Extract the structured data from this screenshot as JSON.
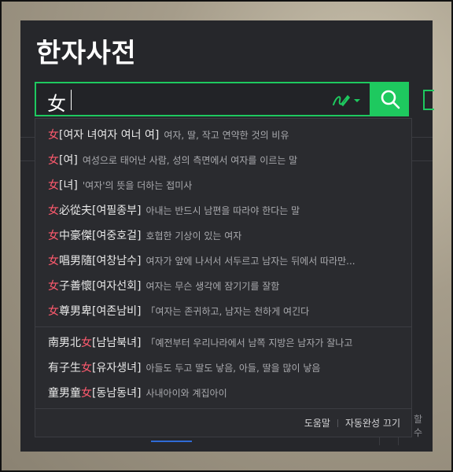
{
  "title": "한자사전",
  "search": {
    "value": "女"
  },
  "dropdown": {
    "items": [
      {
        "pre": "",
        "hl": "女",
        "post": "[여자 녀여자 여너 여]",
        "desc": "여자, 딸, 작고 연약한 것의 비유"
      },
      {
        "pre": "",
        "hl": "女",
        "post": "[여]",
        "desc": "여성으로 태어난 사람, 성의 측면에서 여자를 이르는 말"
      },
      {
        "pre": "",
        "hl": "女",
        "post": "[녀]",
        "desc": "'여자'의 뜻을 더하는 접미사"
      },
      {
        "pre": "",
        "hl": "女",
        "post": "必從夫[여필종부]",
        "desc": "아내는 반드시 남편을 따라야 한다는 말"
      },
      {
        "pre": "",
        "hl": "女",
        "post": "中豪傑[여중호걸]",
        "desc": "호협한 기상이 있는 여자"
      },
      {
        "pre": "",
        "hl": "女",
        "post": "唱男隨[여창남수]",
        "desc": "여자가 앞에 나서서 서두르고 남자는 뒤에서 따라만..."
      },
      {
        "pre": "",
        "hl": "女",
        "post": "子善懷[여자선회]",
        "desc": "여자는 무슨 생각에 잠기기를 잘함"
      },
      {
        "pre": "",
        "hl": "女",
        "post": "尊男卑[여존남비]",
        "desc": "「여자는 존귀하고, 남자는 천하게 여긴다"
      },
      {
        "pre": "南男北",
        "hl": "女",
        "post": "[남남북녀]",
        "desc": "「예전부터 우리나라에서 남쪽 지방은 남자가 잘나고"
      },
      {
        "pre": "有子生",
        "hl": "女",
        "post": "[유자생녀]",
        "desc": "아들도 두고 딸도 낳음, 아들, 딸을 많이 낳음"
      },
      {
        "pre": "童男童",
        "hl": "女",
        "post": "[동남동녀]",
        "desc": "사내아이와 계집아이"
      }
    ],
    "footer": {
      "help": "도움말",
      "autocomplete_off": "자동완성 끄기"
    }
  },
  "background": {
    "cut_text": "할 수"
  },
  "colors": {
    "accent": "#1ec95f",
    "highlight": "#ff5a6e",
    "panel": "#26272b"
  },
  "icons": [
    "handwriting-icon",
    "chevron-down-icon",
    "search-icon"
  ]
}
